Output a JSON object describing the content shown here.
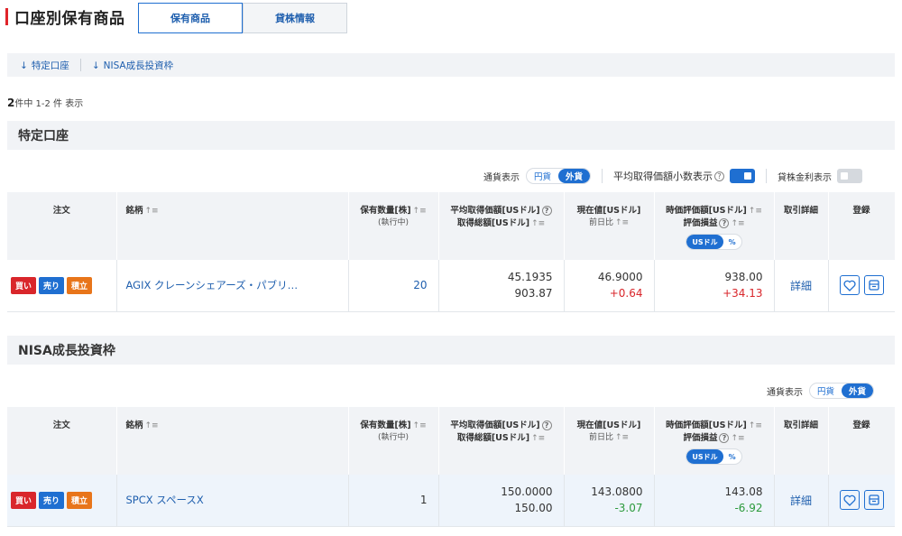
{
  "header": {
    "title": "口座別保有商品",
    "tabs": [
      "保有商品",
      "貸株情報"
    ]
  },
  "jump": {
    "links": [
      "特定口座",
      "NISA成長投資枠"
    ],
    "arrow": "↓"
  },
  "count": {
    "total": "2",
    "rest": "件中 1-2 件 表示"
  },
  "sections": [
    {
      "title": "特定口座",
      "toolbar": {
        "currency_label": "通貨表示",
        "yen": "円貨",
        "foreign": "外貨",
        "avg_decimal_label": "平均取得価額小数表示",
        "lending_label": "貸株金利表示"
      },
      "row": {
        "buy": "買い",
        "sell": "売り",
        "accum": "積立",
        "name": "AGIX クレーンシェアーズ・パブリ…",
        "qty": "20",
        "avg_price": "45.1935",
        "total_cost": "903.87",
        "price": "46.9000",
        "change": "+0.64",
        "mkt_value": "938.00",
        "pnl": "+34.13",
        "detail": "詳細"
      }
    },
    {
      "title": "NISA成長投資枠",
      "toolbar": {
        "currency_label": "通貨表示",
        "yen": "円貨",
        "foreign": "外貨"
      },
      "row": {
        "buy": "買い",
        "sell": "売り",
        "accum": "積立",
        "name": "SPCX スペースX",
        "qty": "1",
        "avg_price": "150.0000",
        "total_cost": "150.00",
        "price": "143.0800",
        "change": "-3.07",
        "mkt_value": "143.08",
        "pnl": "-6.92",
        "detail": "詳細"
      }
    }
  ],
  "columns": {
    "order": "注文",
    "name": "銘柄",
    "qty": "保有数量[株]",
    "qty_sub": "(執行中)",
    "avg_price": "平均取得価額[USドル]",
    "total_cost": "取得総額[USドル]",
    "price": "現在値[USドル]",
    "change": "前日比",
    "mkt_value": "時価評価額[USドル]",
    "pnl": "評価損益",
    "toggle_usd": "USドル",
    "toggle_pct": "%",
    "detail": "取引詳細",
    "register": "登録"
  },
  "icons": {
    "sort": "sort-icon",
    "help": "question-icon",
    "favorite": "heart-icon",
    "alert": "ticker-alert-icon"
  },
  "colors": {
    "brand_red": "#e0242a",
    "accent_blue": "#1f6fd1",
    "gain": "#d9262b",
    "loss": "#2c9a3c",
    "accumulate": "#e8751a"
  }
}
